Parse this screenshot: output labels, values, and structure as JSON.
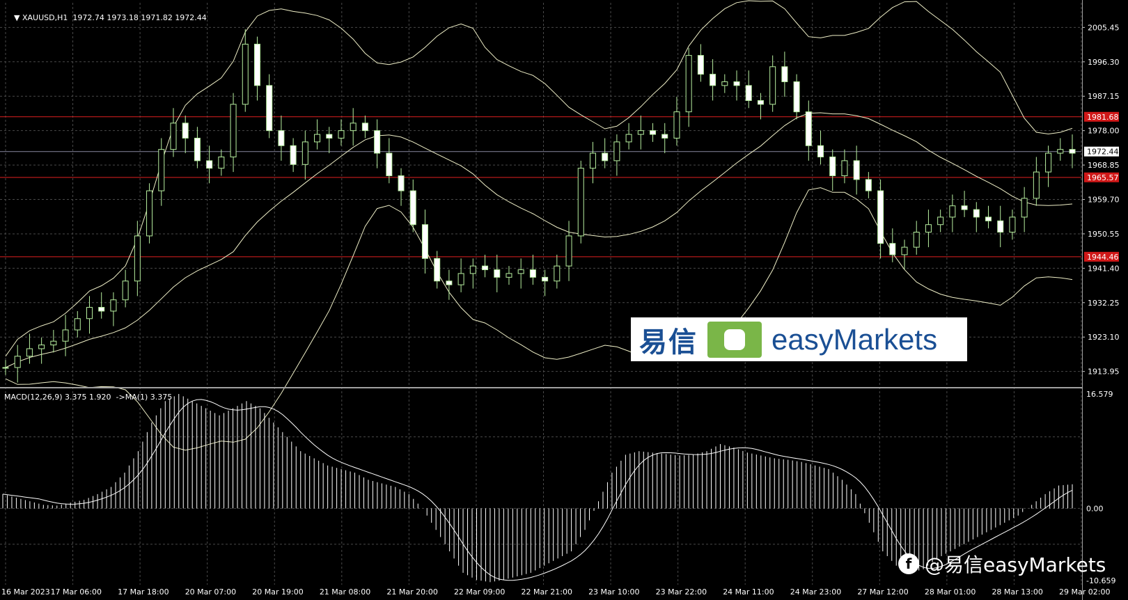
{
  "header": {
    "symbol": "XAUUSD,H1",
    "ohlc": "1972.74 1973.18 1971.82 1972.44",
    "macd_label": "MACD(12,26,9) 3.375 1.920  ->MA(1) 3.375"
  },
  "price_axis": {
    "ticks": [
      "2005.45",
      "1996.30",
      "1987.15",
      "1978.00",
      "1968.85",
      "1959.70",
      "1950.55",
      "1941.40",
      "1932.25",
      "1923.10",
      "1913.95"
    ],
    "current_price": "1972.44",
    "levels": [
      {
        "label": "1981.68",
        "value": 1981.68
      },
      {
        "label": "1965.57",
        "value": 1965.57
      },
      {
        "label": "1944.46",
        "value": 1944.46
      }
    ]
  },
  "macd_axis": {
    "top": "16.579",
    "zero": "0.00",
    "bottom": "-10.659"
  },
  "time_axis": [
    "16 Mar 2023",
    "17 Mar 06:00",
    "17 Mar 18:00",
    "20 Mar 07:00",
    "20 Mar 19:00",
    "21 Mar 08:00",
    "21 Mar 20:00",
    "22 Mar 09:00",
    "22 Mar 21:00",
    "23 Mar 10:00",
    "23 Mar 22:00",
    "24 Mar 11:00",
    "24 Mar 23:00",
    "27 Mar 12:00",
    "28 Mar 01:00",
    "28 Mar 13:00",
    "29 Mar 02:00"
  ],
  "colors": {
    "background": "#000000",
    "grid": "#4a4a4a",
    "candle_up": "#000000",
    "candle_outline": "#b8f0a0",
    "bands": "#f0f0c8",
    "level_line": "#e02020",
    "price_line": "#8888a0"
  },
  "logo": {
    "cn": "易信",
    "en": "easyMarkets",
    "badge_icon": "easymarkets-badge-icon"
  },
  "watermark": {
    "icon": "facebook-icon",
    "text": "@易信easyMarkets"
  },
  "chart_data": {
    "type": "candlestick",
    "symbol": "XAUUSD",
    "timeframe": "H1",
    "ylim": [
      1910.0,
      2012.0
    ],
    "macd_ylim": [
      -10.659,
      16.579
    ],
    "close_path": [
      1915,
      1918,
      1920,
      1921,
      1922,
      1925,
      1928,
      1931,
      1930,
      1933,
      1938,
      1950,
      1962,
      1973,
      1980,
      1976,
      1970,
      1968,
      1971,
      1985,
      2001,
      1990,
      1978,
      1974,
      1969,
      1975,
      1977,
      1976,
      1978,
      1980,
      1978,
      1972,
      1966,
      1962,
      1953,
      1944,
      1938,
      1937,
      1940,
      1942,
      1941,
      1939,
      1940,
      1941,
      1939,
      1938,
      1942,
      1950,
      1968,
      1972,
      1970,
      1975,
      1977,
      1978,
      1977,
      1976,
      1983,
      1998,
      1993,
      1990,
      1991,
      1990,
      1986,
      1985,
      1995,
      1991,
      1983,
      1974,
      1971,
      1966,
      1970,
      1965,
      1962,
      1948,
      1945,
      1947,
      1951,
      1953,
      1955,
      1958,
      1957,
      1955,
      1954,
      1951,
      1955,
      1960,
      1967,
      1972,
      1973,
      1972
    ],
    "macd_hist_path": [
      2,
      1.5,
      1,
      0.5,
      0.4,
      0.8,
      1.2,
      2,
      3,
      5,
      8,
      12,
      15,
      16,
      15,
      14,
      13,
      14,
      15,
      14,
      12,
      10,
      8,
      7,
      6,
      5.5,
      5,
      4,
      3.5,
      3,
      2,
      0,
      -3,
      -6,
      -9,
      -10,
      -10.3,
      -10,
      -9.5,
      -9,
      -8,
      -7,
      -6,
      -3,
      1,
      5,
      7.5,
      8,
      7.8,
      7.6,
      7.4,
      7.5,
      8,
      9,
      8.5,
      7.8,
      7.4,
      7,
      6.8,
      6.5,
      6,
      5.5,
      4,
      2,
      -2,
      -6,
      -8,
      -9,
      -8.5,
      -7,
      -6,
      -5,
      -4,
      -3,
      -2,
      -1,
      0.5,
      2,
      3.2,
      3.375
    ]
  }
}
